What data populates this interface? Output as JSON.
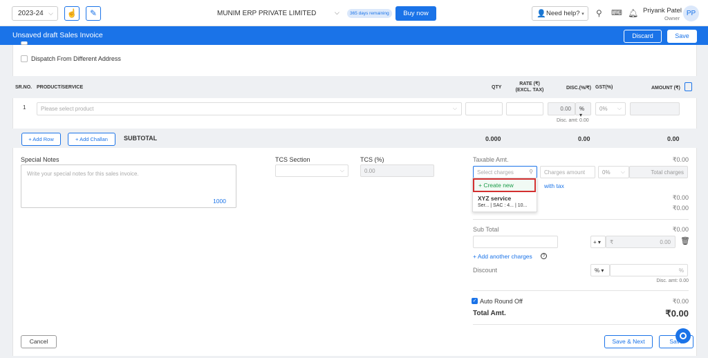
{
  "topbar": {
    "year": "2023-24",
    "company": "MUNIM ERP PRIVATE LIMITED",
    "days_remaining": "365 days remaining",
    "buy_now": "Buy now",
    "need_help": "Need help?",
    "user_name": "Priyank Patel",
    "user_role": "Owner",
    "avatar_initials": "PP"
  },
  "header": {
    "title": "Unsaved draft Sales Invoice",
    "discard": "Discard",
    "save": "Save"
  },
  "form": {
    "dispatch_label": "Dispatch From Different Address"
  },
  "table": {
    "headers": {
      "srno": "SR.NO.",
      "product": "PRODUCT/SERVICE",
      "qty": "QTY",
      "rate_line1": "RATE (₹)",
      "rate_line2": "(EXCL. TAX)",
      "disc": "DISC.(%/₹)",
      "gst": "GST(%)",
      "amount": "AMOUNT (₹)"
    },
    "rows": [
      {
        "srno": "1",
        "product_placeholder": "Please select product",
        "disc_value": "0.00",
        "disc_type": "%",
        "gst": "0%",
        "disc_amt": "Disc. amt: 0.00"
      }
    ]
  },
  "subtotal_bar": {
    "add_row": "+ Add Row",
    "add_challan": "+ Add Challan",
    "label": "SUBTOTAL",
    "qty": "0.000",
    "disc": "0.00",
    "amount": "0.00"
  },
  "notes": {
    "label": "Special Notes",
    "placeholder": "Write your special notes for this sales invoice.",
    "char_count": "1000"
  },
  "tcs": {
    "section_label": "TCS Section",
    "percent_label": "TCS (%)",
    "percent_value": "0.00"
  },
  "summary": {
    "taxable_label": "Taxable Amt.",
    "taxable_value": "₹0.00",
    "charges_placeholder": "Select charges",
    "charges_amount_placeholder": "Charges amount",
    "charges_gst": "0%",
    "total_charges_placeholder": "Total charges",
    "with_tax_text": "with tax",
    "dropdown_create_new": "+ Create new",
    "dropdown_item_name": "XYZ service",
    "dropdown_item_sub": "Ser... | SAC : 4... | 10...",
    "value_1": "₹0.00",
    "value_2": "₹0.00",
    "subtotal_label": "Sub Total",
    "subtotal_value": "₹0.00",
    "adjust_sign": "+",
    "adjust_currency": "₹",
    "adjust_value": "0.00",
    "add_another_charges": "+ Add another charges",
    "discount_label": "Discount",
    "discount_type": "%",
    "discount_suffix": "%",
    "disc_amt": "Disc. amt: 0.00",
    "auto_round_off": "Auto Round Off",
    "round_off_value": "₹0.00",
    "total_label": "Total Amt.",
    "total_value": "₹0.00"
  },
  "footer": {
    "cancel": "Cancel",
    "save_next": "Save & Next",
    "save": "Save"
  }
}
